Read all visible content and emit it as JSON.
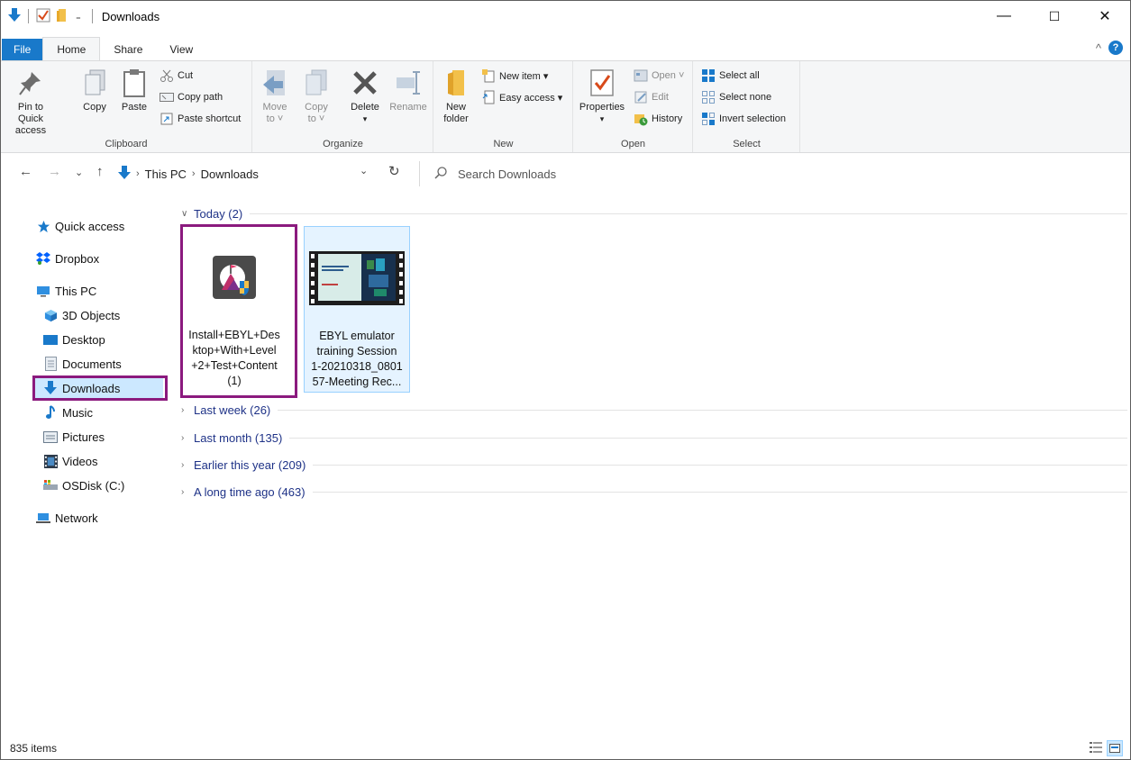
{
  "window": {
    "title": "Downloads",
    "minimize": "—",
    "maximize": "☐",
    "close": "✕"
  },
  "tabs": {
    "file": "File",
    "home": "Home",
    "share": "Share",
    "view": "View"
  },
  "ribbon": {
    "clipboard": {
      "label": "Clipboard",
      "pin_line1": "Pin to Quick",
      "pin_line2": "access",
      "copy": "Copy",
      "paste": "Paste",
      "cut": "Cut",
      "copy_path": "Copy path",
      "paste_shortcut": "Paste shortcut"
    },
    "organize": {
      "label": "Organize",
      "move_to_line1": "Move",
      "move_to_line2": "to ˅",
      "copy_to_line1": "Copy",
      "copy_to_line2": "to ˅",
      "delete": "Delete",
      "rename": "Rename"
    },
    "new": {
      "label": "New",
      "new_folder_line1": "New",
      "new_folder_line2": "folder",
      "new_item": "New item ▾",
      "easy_access": "Easy access ▾"
    },
    "open": {
      "label": "Open",
      "properties": "Properties",
      "open": "Open ˅",
      "edit": "Edit",
      "history": "History"
    },
    "select": {
      "label": "Select",
      "select_all": "Select all",
      "select_none": "Select none",
      "invert_selection": "Invert selection"
    }
  },
  "address": {
    "crumbs": [
      "This PC",
      "Downloads"
    ],
    "search_placeholder": "Search Downloads"
  },
  "nav": {
    "quick_access": "Quick access",
    "dropbox": "Dropbox",
    "this_pc": "This PC",
    "objects_3d": "3D Objects",
    "desktop": "Desktop",
    "documents": "Documents",
    "downloads": "Downloads",
    "music": "Music",
    "pictures": "Pictures",
    "videos": "Videos",
    "osdisk": "OSDisk (C:)",
    "network": "Network"
  },
  "groups": {
    "today": "Today (2)",
    "last_week": "Last week (26)",
    "last_month": "Last month (135)",
    "earlier_this_year": "Earlier this year (209)",
    "long_time_ago": "A long time ago (463)"
  },
  "files": [
    {
      "name": "Install+EBYL+Desktop+With+Level+2+Test+Content (1)",
      "lines": [
        "Install+EBYL+Des",
        "ktop+With+Level",
        "+2+Test+Content",
        "(1)"
      ]
    },
    {
      "name": "EBYL emulator training Session 1-20210318_080157-Meeting Rec...",
      "lines": [
        "EBYL emulator",
        "training Session",
        "1-20210318_0801",
        "57-Meeting Rec..."
      ]
    }
  ],
  "status": {
    "item_count": "835 items"
  },
  "colors": {
    "accent": "#1979ca",
    "highlight": "#8b1a7e",
    "selection": "#cce8ff",
    "group_header": "#1e3287"
  }
}
